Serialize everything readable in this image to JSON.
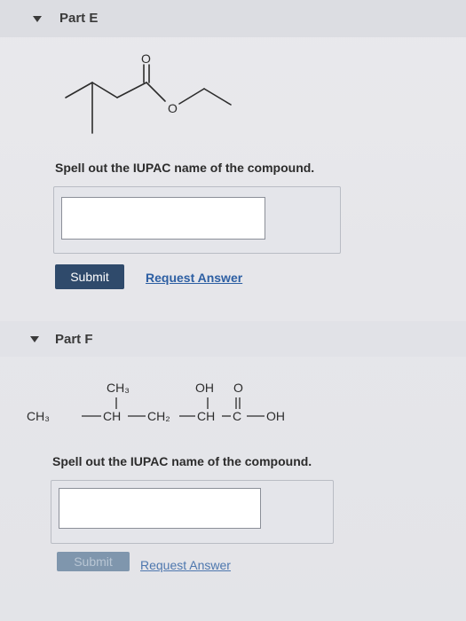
{
  "part_e": {
    "title": "Part E",
    "structure_atoms": {
      "carbonyl_o": "O",
      "ester_o": "O"
    },
    "prompt": "Spell out the IUPAC name of the compound.",
    "answer_value": "",
    "submit_label": "Submit",
    "request_label": "Request Answer"
  },
  "part_f": {
    "title": "Part F",
    "formula": {
      "branch_top": "CH3",
      "oh_label": "OH",
      "o_label": "O",
      "chain": [
        "CH3",
        "CH",
        "CH2",
        "CH",
        "C",
        "OH"
      ]
    },
    "prompt": "Spell out the IUPAC name of the compound.",
    "answer_value": "",
    "submit_label": "Submit",
    "request_label": "Request Answer"
  },
  "colors": {
    "submit_bg": "#2f4a6b",
    "link": "#2d5fa3",
    "header_bg": "#dcdde2"
  }
}
